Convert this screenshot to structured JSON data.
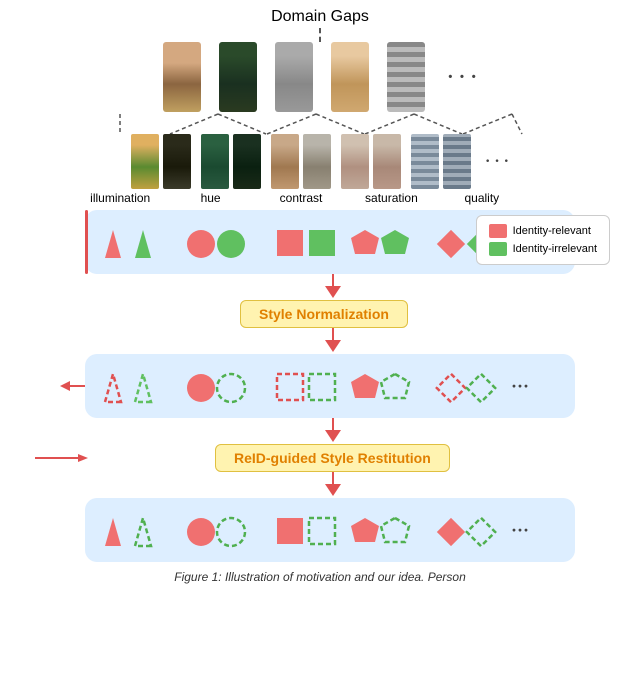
{
  "title": "Domain Gaps",
  "labels": {
    "illumination": "illumination",
    "hue": "hue",
    "contrast": "contrast",
    "saturation": "saturation",
    "quality": "quality",
    "dots": "· · ·",
    "style_normalization": "Style Normalization",
    "reid_style_restitution": "ReID-guided Style Restitution",
    "identity_relevant": "Identity-relevant",
    "identity_irrelevant": "Identity-irrelevant",
    "caption": "Figure 1: Illustration of motivation and our idea.   Person"
  },
  "colors": {
    "accent_red": "#e05050",
    "accent_green": "#60c060",
    "yellow_bg": "#fff3b0",
    "blue_bg": "#ddeeff",
    "shape_red": "#f07070",
    "shape_green": "#60c060"
  }
}
